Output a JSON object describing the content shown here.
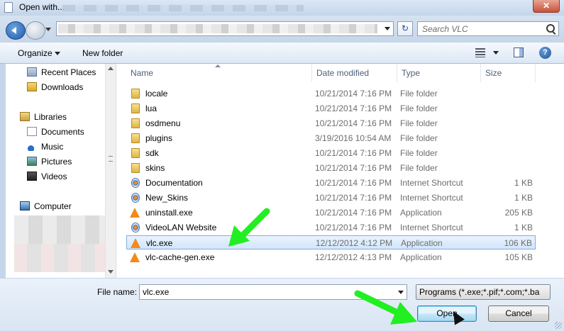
{
  "window": {
    "title": "Open with...",
    "close_glyph": "✕"
  },
  "address": {
    "search_placeholder": "Search VLC",
    "refresh_glyph": "↻"
  },
  "toolbar": {
    "organize_label": "Organize",
    "new_folder_label": "New folder",
    "help_glyph": "?"
  },
  "nav": {
    "items": [
      {
        "label": "Recent Places",
        "icon": "recent-places-icon"
      },
      {
        "label": "Downloads",
        "icon": "downloads-icon"
      },
      {
        "label": "Libraries",
        "icon": "libraries-icon"
      },
      {
        "label": "Documents",
        "icon": "documents-icon"
      },
      {
        "label": "Music",
        "icon": "music-icon"
      },
      {
        "label": "Pictures",
        "icon": "pictures-icon"
      },
      {
        "label": "Videos",
        "icon": "videos-icon"
      },
      {
        "label": "Computer",
        "icon": "computer-icon"
      }
    ]
  },
  "columns": {
    "name": "Name",
    "date": "Date modified",
    "type": "Type",
    "size": "Size"
  },
  "files": [
    {
      "name": "locale",
      "date": "10/21/2014 7:16 PM",
      "type": "File folder",
      "size": "",
      "icon": "folder-icon"
    },
    {
      "name": "lua",
      "date": "10/21/2014 7:16 PM",
      "type": "File folder",
      "size": "",
      "icon": "folder-icon"
    },
    {
      "name": "osdmenu",
      "date": "10/21/2014 7:16 PM",
      "type": "File folder",
      "size": "",
      "icon": "folder-icon"
    },
    {
      "name": "plugins",
      "date": "3/19/2016 10:54 AM",
      "type": "File folder",
      "size": "",
      "icon": "folder-icon"
    },
    {
      "name": "sdk",
      "date": "10/21/2014 7:16 PM",
      "type": "File folder",
      "size": "",
      "icon": "folder-icon"
    },
    {
      "name": "skins",
      "date": "10/21/2014 7:16 PM",
      "type": "File folder",
      "size": "",
      "icon": "folder-icon"
    },
    {
      "name": "Documentation",
      "date": "10/21/2014 7:16 PM",
      "type": "Internet Shortcut",
      "size": "1 KB",
      "icon": "internet-shortcut-icon"
    },
    {
      "name": "New_Skins",
      "date": "10/21/2014 7:16 PM",
      "type": "Internet Shortcut",
      "size": "1 KB",
      "icon": "internet-shortcut-icon"
    },
    {
      "name": "uninstall.exe",
      "date": "10/21/2014 7:16 PM",
      "type": "Application",
      "size": "205 KB",
      "icon": "vlc-cone-icon"
    },
    {
      "name": "VideoLAN Website",
      "date": "10/21/2014 7:16 PM",
      "type": "Internet Shortcut",
      "size": "1 KB",
      "icon": "internet-shortcut-icon"
    },
    {
      "name": "vlc.exe",
      "date": "12/12/2012 4:12 PM",
      "type": "Application",
      "size": "106 KB",
      "icon": "vlc-cone-icon",
      "selected": true
    },
    {
      "name": "vlc-cache-gen.exe",
      "date": "12/12/2012 4:13 PM",
      "type": "Application",
      "size": "105 KB",
      "icon": "vlc-cone-icon"
    }
  ],
  "footer": {
    "file_name_label": "File name:",
    "file_name_value": "vlc.exe",
    "file_type_value": "Programs (*.exe;*.pif;*.com;*.ba",
    "open_label": "Open",
    "cancel_label": "Cancel"
  },
  "colors": {
    "annotation_arrow": "#22ee22",
    "selection": "#d2e6fb"
  }
}
